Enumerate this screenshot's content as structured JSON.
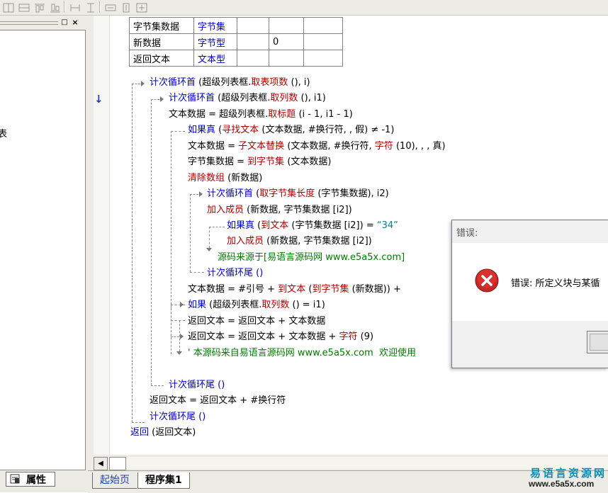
{
  "left_panel": {
    "maximize_glyph": "□",
    "close_glyph": "×",
    "fragment_text": "表",
    "properties_tab_label": "属性"
  },
  "var_table": {
    "rows": [
      {
        "name": "字节集数据",
        "type": "字节集",
        "c3": "",
        "c4": "",
        "c5": ""
      },
      {
        "name": "新数据",
        "type": "字节型",
        "c3": "",
        "c4": "0",
        "c5": ""
      },
      {
        "name": "返回文本",
        "type": "文本型",
        "c3": "",
        "c4": "",
        "c5": ""
      }
    ]
  },
  "margin_marker": "↓",
  "code": {
    "l1_a": "计次循环首",
    "l1_b": " (超级列表框.",
    "l1_c": "取表项数",
    "l1_d": " (), i)",
    "l2_a": "计次循环首",
    "l2_b": " (超级列表框.",
    "l2_c": "取列数",
    "l2_d": " (), i1)",
    "l3_a": "文本数据 = 超级列表框.",
    "l3_b": "取标题",
    "l3_c": " (i - 1, i1 - 1)",
    "l4_a": "如果真",
    "l4_b": " (",
    "l4_c": "寻找文本",
    "l4_d": " (文本数据, #换行符, , 假) ≠ -1)",
    "l5_a": "文本数据 = ",
    "l5_b": "子文本替换",
    "l5_c": " (文本数据, #换行符, ",
    "l5_d": "字符",
    "l5_e": " (10), , , 真)",
    "l6_a": "字节集数据 = ",
    "l6_b": "到字节集",
    "l6_c": " (文本数据)",
    "l7_a": "清除数组",
    "l7_b": " (新数据)",
    "l8_a": "计次循环首",
    "l8_b": " (",
    "l8_c": "取字节集长度",
    "l8_d": " (字节集数据), i2)",
    "l9_a": "加入成员",
    "l9_b": " (新数据, 字节集数据 [i2])",
    "l10_a": "如果真",
    "l10_b": " (",
    "l10_c": "到文本",
    "l10_d": " (字节集数据 [i2]) = ",
    "l10_e": "“34”",
    "l11_a": "加入成员",
    "l11_b": " (新数据, 字节集数据 [i2])",
    "l12": "源码来源于[易语言源码网 www.e5a5x.com]",
    "l13": "计次循环尾 ()",
    "l14_a": "文本数据 = #引号 + ",
    "l14_b": "到文本",
    "l14_c": " (",
    "l14_d": "到字节集",
    "l14_e": " (新数据)) +",
    "l15_a": "如果",
    "l15_b": " (超级列表框.",
    "l15_c": "取列数",
    "l15_d": " () = i1)",
    "l16": "返回文本 = 返回文本 + 文本数据",
    "l17_a": "返回文本 = 返回文本 + 文本数据 + ",
    "l17_b": "字符",
    "l17_c": " (9)",
    "l18": "' 本源码来自易语言源码网 www.e5a5x.com  欢迎使用",
    "l19": "计次循环尾 ()",
    "l20": "返回文本 = 返回文本 + #换行符",
    "l21": "计次循环尾 ()",
    "l22_a": "返回",
    "l22_b": " (返回文本)"
  },
  "tabs": [
    "起始页",
    "程序集1"
  ],
  "watermark": {
    "line1": "易语言资源网",
    "line2": "www.e5a5x.com"
  },
  "dialog": {
    "title": "错误:",
    "message": "错误: 所定义块与某循"
  },
  "colors": {
    "keyword_blue": "#0000c8",
    "method_red": "#b00000",
    "comment_green": "#007a00",
    "error_red": "#d32f2f"
  }
}
